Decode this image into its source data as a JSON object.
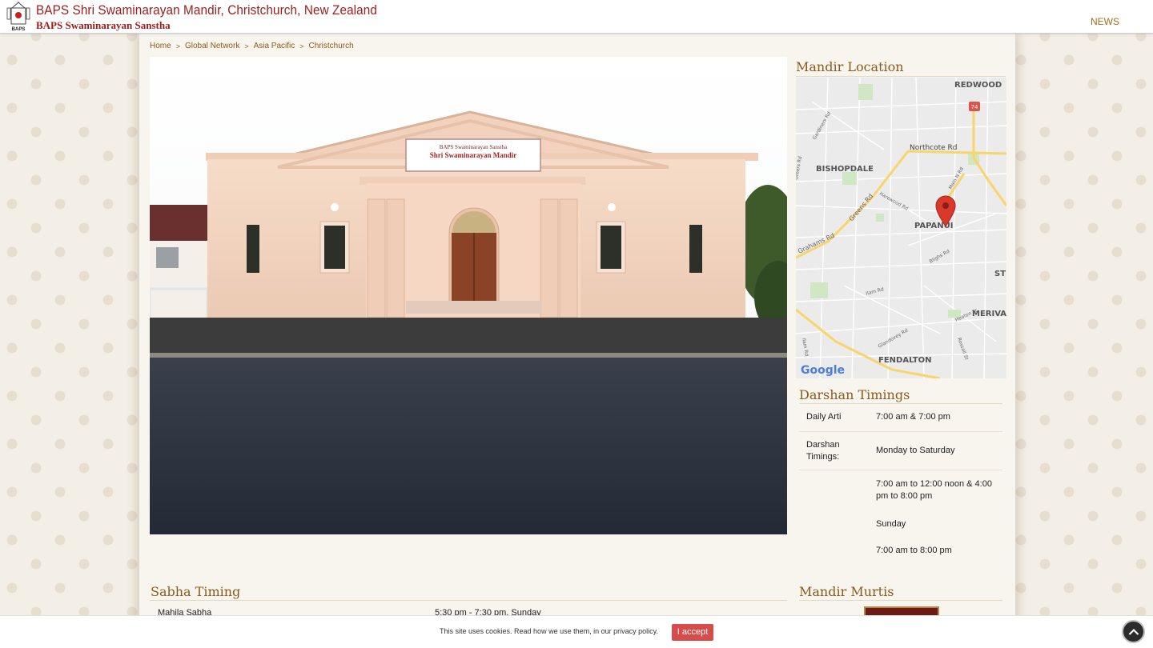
{
  "header": {
    "logo_text": "BAPS",
    "title": "BAPS Shri Swaminarayan Mandir, Christchurch, New Zealand",
    "subtitle": "BAPS Swaminarayan Sanstha",
    "nav": [
      {
        "label": "NEWS"
      }
    ]
  },
  "breadcrumb": [
    {
      "label": "Home"
    },
    {
      "label": "Global Network"
    },
    {
      "label": "Asia Pacific"
    },
    {
      "label": "Christchurch"
    }
  ],
  "breadcrumb_separator": ">",
  "hero": {
    "sign_line1": "BAPS Swaminarayan Sanstha",
    "sign_line2": "Shri Swaminarayan Mandir"
  },
  "location": {
    "heading": "Mandir Location",
    "map_labels": {
      "redwood": "REDWOOD",
      "route_74": "74",
      "northcote": "Northcote Rd",
      "bishopdale": "BISHOPDALE",
      "harewood": "Harewood Rd",
      "greens": "Greens Rd",
      "grahams": "Grahams Rd",
      "papanui": "PAPANUI",
      "main_n": "Main N Rd",
      "blighs": "Blighs Rd",
      "ilam": "Ilam Rd",
      "heaton": "Heaton St",
      "merivale": "MERIVA",
      "st_albans": "ST",
      "glandovey": "Glandovey Rd",
      "rossall": "Rossall St",
      "fendalton": "FENDALTON",
      "gardiners": "Gardiners Rd",
      "greers": "Greers Rd",
      "ilam_v": "Ilam Rd",
      "google": "Google"
    }
  },
  "darshan": {
    "heading": "Darshan Timings",
    "rows": [
      {
        "label": "Daily Arti",
        "value": "7:00 am & 7:00 pm"
      },
      {
        "label": "Darshan Timings:",
        "value": "Monday to Saturday"
      },
      {
        "label": "",
        "value": "7:00 am to 12:00 noon & 4:00 pm to 8:00 pm"
      },
      {
        "label": "",
        "value": "Sunday"
      },
      {
        "label": "",
        "value": "7:00 am to 8:00 pm"
      }
    ]
  },
  "sabha": {
    "heading": "Sabha Timing",
    "rows": [
      {
        "name": "Mahila Sabha",
        "time": "5:30 pm - 7:30 pm, Sunday"
      }
    ]
  },
  "murtis": {
    "heading": "Mandir Murtis"
  },
  "cookie": {
    "text": "This site uses cookies. Read how we use them, in our privacy policy.",
    "accept_label": "I accept"
  },
  "colors": {
    "brand_red": "#9b1c1c",
    "accent_brown": "#8a5a1b",
    "cookie_button": "#d84b4b"
  },
  "icons": {
    "logo": "baps-logo-icon",
    "map_pin": "map-pin-icon",
    "back_to_top": "chevron-up-icon"
  }
}
